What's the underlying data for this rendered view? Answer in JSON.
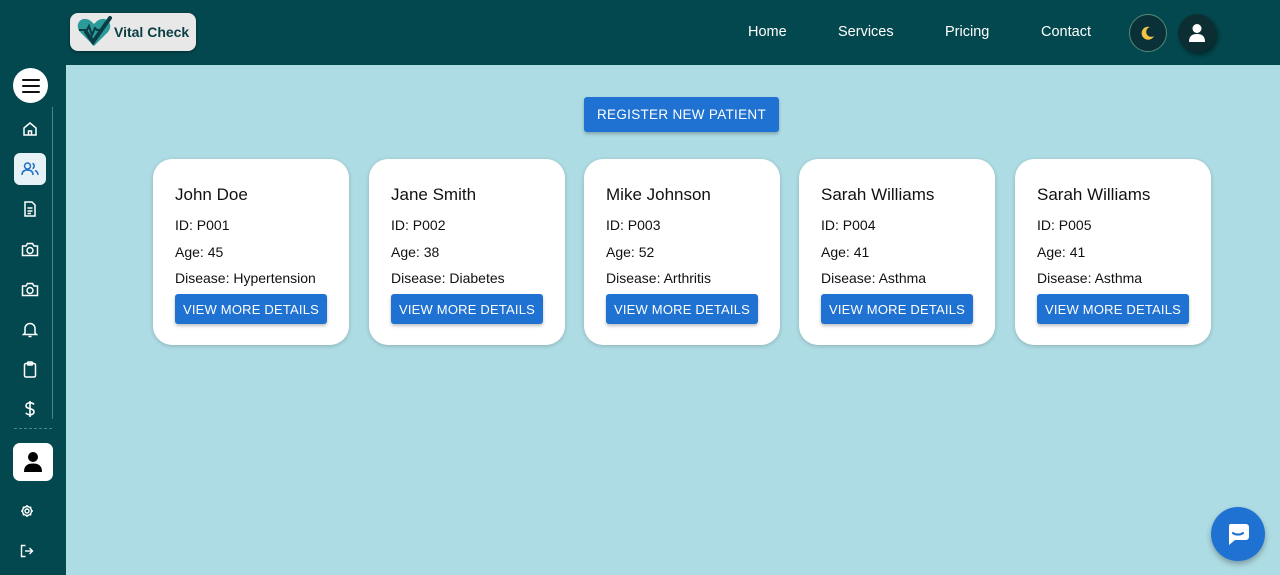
{
  "brand": {
    "name": "Vital Check"
  },
  "nav": {
    "links": [
      "Home",
      "Services",
      "Pricing",
      "Contact"
    ],
    "theme_toggle_icon": "moon-icon",
    "account_icon": "user-icon"
  },
  "sidebar": {
    "menu_icon": "hamburger-icon",
    "items": [
      {
        "icon": "home-icon",
        "active": false
      },
      {
        "icon": "users-icon",
        "active": true
      },
      {
        "icon": "document-icon",
        "active": false
      },
      {
        "icon": "camera-icon",
        "active": false
      },
      {
        "icon": "camera-icon",
        "active": false
      },
      {
        "icon": "bell-icon",
        "active": false
      },
      {
        "icon": "clipboard-icon",
        "active": false
      },
      {
        "icon": "dollar-icon",
        "active": false
      }
    ],
    "bottom_icons": [
      "profile-icon",
      "settings-icon",
      "logout-icon"
    ]
  },
  "main": {
    "register_label": "REGISTER NEW PATIENT",
    "details_label": "VIEW MORE DETAILS",
    "patients": [
      {
        "name": "John Doe",
        "id": "ID: P001",
        "age": "Age: 45",
        "disease": "Disease: Hypertension"
      },
      {
        "name": "Jane Smith",
        "id": "ID: P002",
        "age": "Age: 38",
        "disease": "Disease: Diabetes"
      },
      {
        "name": "Mike Johnson",
        "id": "ID: P003",
        "age": "Age: 52",
        "disease": "Disease: Arthritis"
      },
      {
        "name": "Sarah Williams",
        "id": "ID: P004",
        "age": "Age: 41",
        "disease": "Disease: Asthma"
      },
      {
        "name": "Sarah Williams",
        "id": "ID: P005",
        "age": "Age: 41",
        "disease": "Disease: Asthma"
      }
    ]
  },
  "chat": {
    "icon": "chat-icon"
  },
  "colors": {
    "header_bg": "#03484e",
    "page_bg": "#aedce4",
    "button_blue": "#1f72d2"
  }
}
